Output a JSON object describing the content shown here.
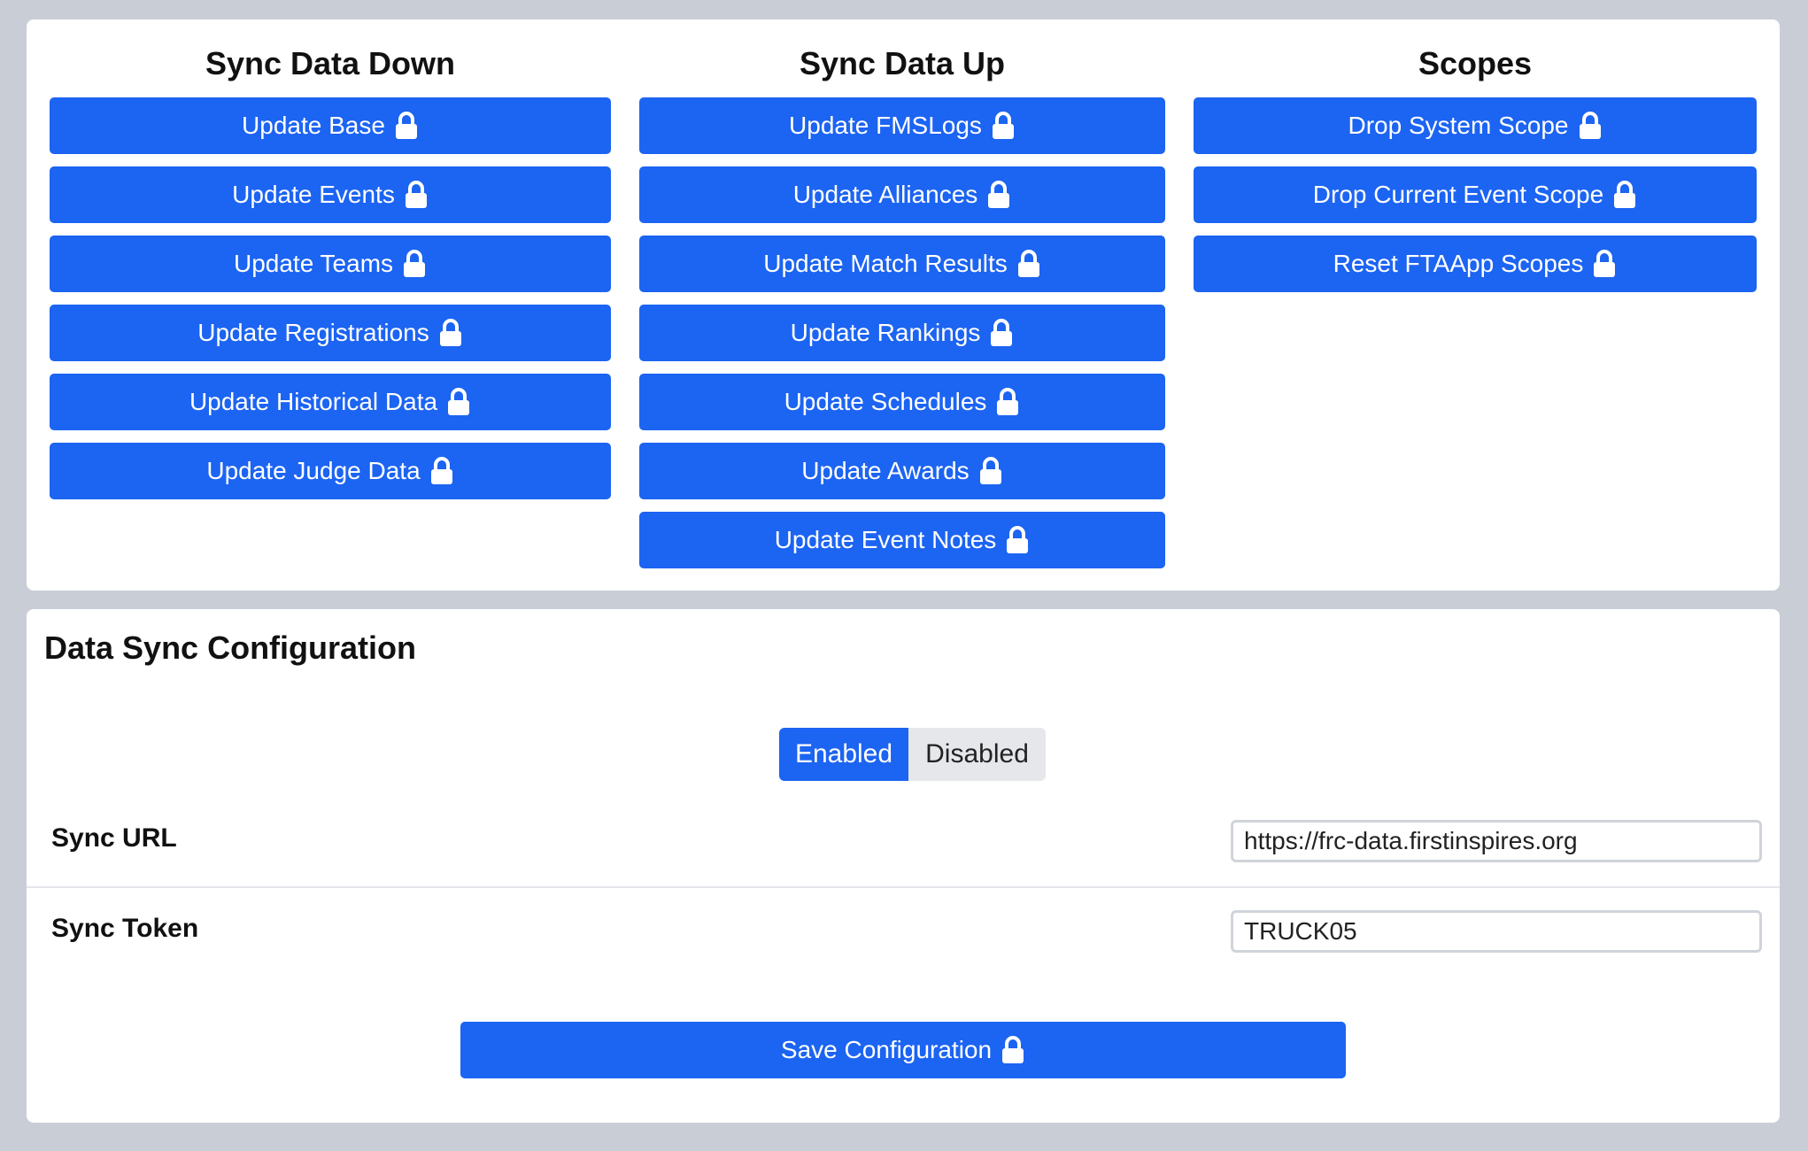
{
  "sync_panel": {
    "down": {
      "heading": "Sync Data Down",
      "buttons": [
        "Update Base",
        "Update Events",
        "Update Teams",
        "Update Registrations",
        "Update Historical Data",
        "Update Judge Data"
      ]
    },
    "up": {
      "heading": "Sync Data Up",
      "buttons": [
        "Update FMSLogs",
        "Update Alliances",
        "Update Match Results",
        "Update Rankings",
        "Update Schedules",
        "Update Awards",
        "Update Event Notes"
      ]
    },
    "scopes": {
      "heading": "Scopes",
      "buttons": [
        "Drop System Scope",
        "Drop Current Event Scope",
        "Reset FTAApp Scopes"
      ]
    },
    "button_icon": "lock-icon"
  },
  "config": {
    "title": "Data Sync Configuration",
    "toggle": {
      "enabled_label": "Enabled",
      "disabled_label": "Disabled",
      "selected": "Enabled"
    },
    "sync_url": {
      "label": "Sync URL",
      "value": "https://frc-data.firstinspires.org"
    },
    "sync_token": {
      "label": "Sync Token",
      "value": "TRUCK05"
    },
    "save_label": "Save Configuration"
  },
  "colors": {
    "primary": "#1c64f2",
    "background": "#c9ced6",
    "card": "#ffffff",
    "toggle_inactive": "#e5e7eb"
  }
}
